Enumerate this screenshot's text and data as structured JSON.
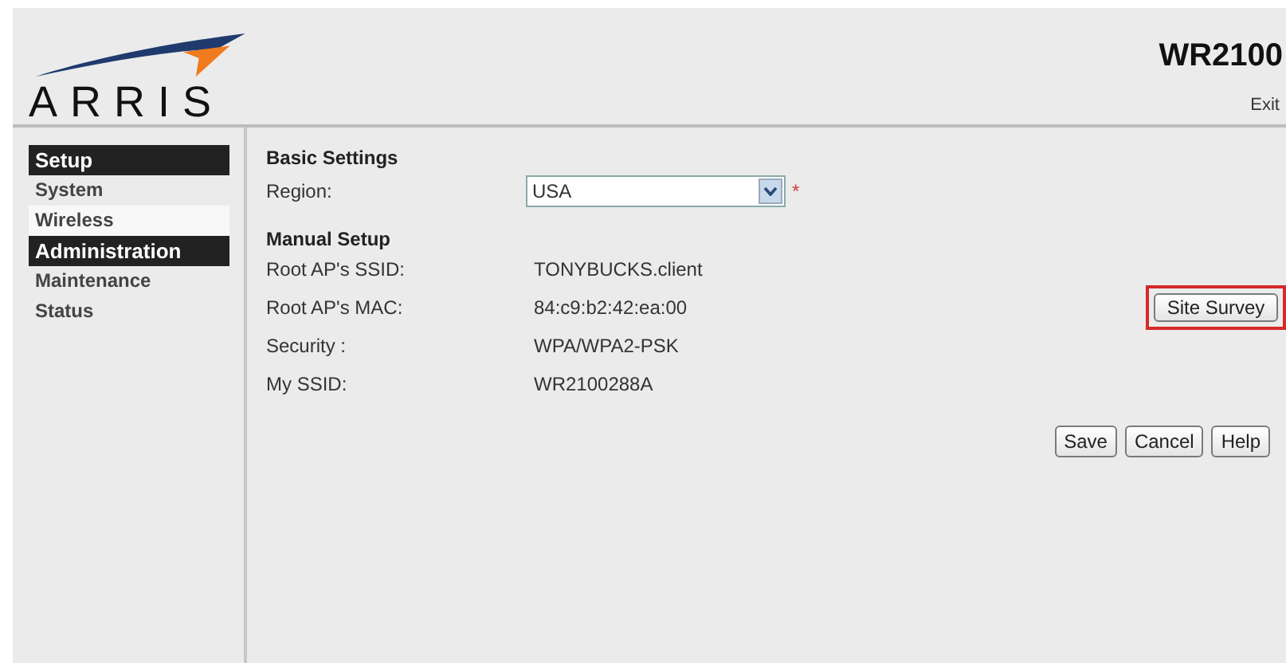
{
  "header": {
    "brand": "ARRIS",
    "model": "WR2100",
    "exit": "Exit"
  },
  "sidebar": {
    "items": [
      {
        "kind": "header",
        "label": "Setup"
      },
      {
        "kind": "item",
        "label": "System",
        "selected": false
      },
      {
        "kind": "item",
        "label": "Wireless",
        "selected": true
      },
      {
        "kind": "header",
        "label": "Administration"
      },
      {
        "kind": "item",
        "label": "Maintenance",
        "selected": false
      },
      {
        "kind": "item",
        "label": "Status",
        "selected": false
      }
    ]
  },
  "basic": {
    "title": "Basic Settings",
    "region_label": "Region:",
    "region_value": "USA",
    "required_mark": "*"
  },
  "manual": {
    "title": "Manual Setup",
    "rows": [
      {
        "label": "Root AP's SSID:",
        "value": "TONYBUCKS.client"
      },
      {
        "label": "Root AP's MAC:",
        "value": "84:c9:b2:42:ea:00",
        "button": {
          "label": "Site Survey",
          "highlighted": true
        }
      },
      {
        "label": "Security :",
        "value": "WPA/WPA2-PSK"
      },
      {
        "label": "My SSID:",
        "value": "WR2100288A"
      }
    ]
  },
  "buttons": [
    "Save",
    "Cancel",
    "Help"
  ]
}
